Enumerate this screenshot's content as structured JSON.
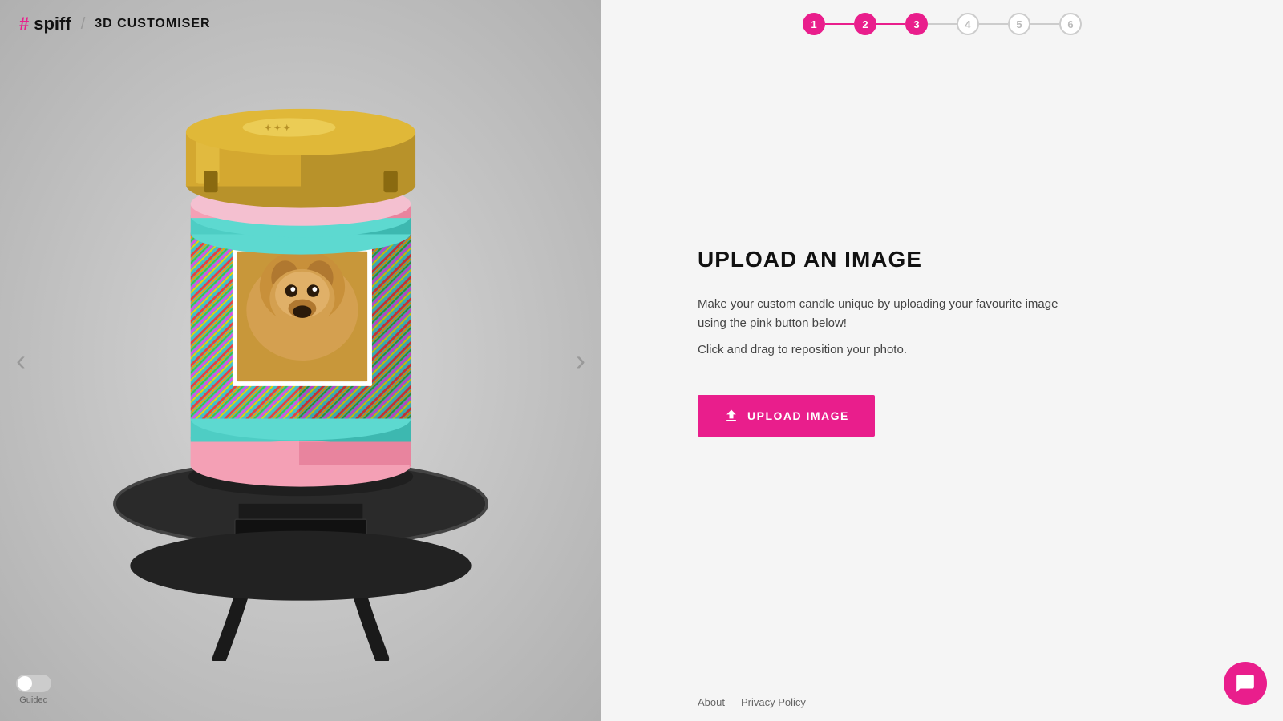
{
  "header": {
    "logo_hash": "#",
    "logo_spiff": "spiff",
    "logo_divider": "/",
    "logo_subtitle": "3D CUSTOMISER"
  },
  "steps": [
    {
      "number": "1",
      "state": "completed"
    },
    {
      "number": "2",
      "state": "completed"
    },
    {
      "number": "3",
      "state": "active"
    },
    {
      "number": "4",
      "state": "inactive"
    },
    {
      "number": "5",
      "state": "inactive"
    },
    {
      "number": "6",
      "state": "inactive"
    }
  ],
  "right_panel": {
    "title": "UPLOAD AN IMAGE",
    "description": "Make your custom candle unique by uploading your favourite image using the pink button below!",
    "hint": "Click and drag to reposition your photo.",
    "upload_button_label": "UPLOAD IMAGE"
  },
  "nav": {
    "left_arrow": "‹",
    "right_arrow": "›"
  },
  "guided": {
    "label": "Guided"
  },
  "footer": {
    "about": "About",
    "privacy": "Privacy Policy"
  },
  "colors": {
    "accent": "#e91e8c",
    "step_active": "#e91e8c",
    "step_inactive": "#ccc"
  }
}
